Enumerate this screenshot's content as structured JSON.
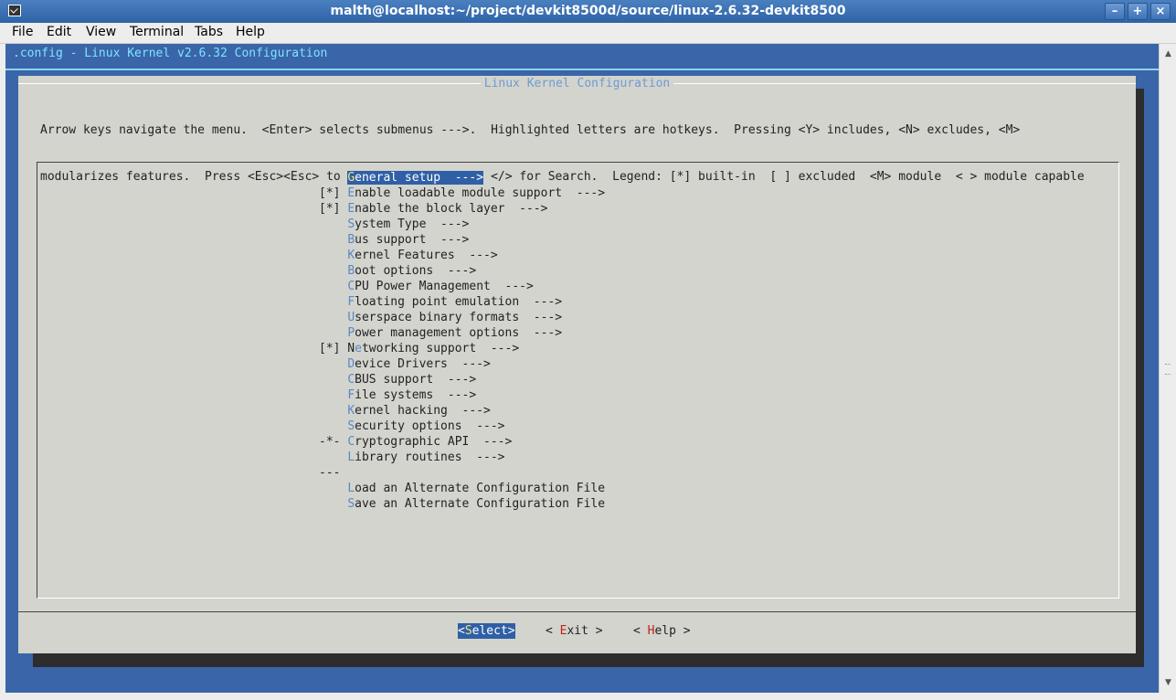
{
  "window": {
    "title": "malth@localhost:~/project/devkit8500d/source/linux-2.6.32-devkit8500",
    "controls": {
      "minimize": "–",
      "maximize": "+",
      "close": "×"
    }
  },
  "menubar": {
    "items": [
      {
        "label": "File"
      },
      {
        "label": "Edit"
      },
      {
        "label": "View"
      },
      {
        "label": "Terminal"
      },
      {
        "label": "Tabs"
      },
      {
        "label": "Help"
      }
    ]
  },
  "terminal": {
    "header": ".config - Linux Kernel v2.6.32 Configuration",
    "dialog_title": "Linux Kernel Configuration",
    "instructions": [
      "Arrow keys navigate the menu.  <Enter> selects submenus --->.  Highlighted letters are hotkeys.  Pressing <Y> includes, <N> excludes, <M>",
      "modularizes features.  Press <Esc><Esc> to exit, <?> for Help, </> for Search.  Legend: [*] built-in  [ ] excluded  <M> module  < > module capable"
    ],
    "menu": [
      {
        "prefix": "    ",
        "hk": "G",
        "rest": "eneral setup  --->",
        "selected": true
      },
      {
        "prefix": "[*] ",
        "hk": "E",
        "rest": "nable loadable module support  --->"
      },
      {
        "prefix": "[*] ",
        "hk": "E",
        "rest": "nable the block layer  --->"
      },
      {
        "prefix": "    ",
        "hk": "S",
        "rest": "ystem Type  --->"
      },
      {
        "prefix": "    ",
        "hk": "B",
        "rest": "us support  --->"
      },
      {
        "prefix": "    ",
        "hk": "K",
        "rest": "ernel Features  --->"
      },
      {
        "prefix": "    ",
        "hk": "B",
        "rest": "oot options  --->"
      },
      {
        "prefix": "    ",
        "hk": "C",
        "rest": "PU Power Management  --->"
      },
      {
        "prefix": "    ",
        "hk": "F",
        "rest": "loating point emulation  --->"
      },
      {
        "prefix": "    ",
        "hk": "U",
        "rest": "serspace binary formats  --->"
      },
      {
        "prefix": "    ",
        "hk": "P",
        "rest": "ower management options  --->"
      },
      {
        "prefix": "[*] N",
        "hk": "e",
        "rest": "tworking support  --->"
      },
      {
        "prefix": "    ",
        "hk": "D",
        "rest": "evice Drivers  --->"
      },
      {
        "prefix": "    ",
        "hk": "C",
        "rest": "BUS support  --->"
      },
      {
        "prefix": "    ",
        "hk": "F",
        "rest": "ile systems  --->"
      },
      {
        "prefix": "    ",
        "hk": "K",
        "rest": "ernel hacking  --->"
      },
      {
        "prefix": "    ",
        "hk": "S",
        "rest": "ecurity options  --->"
      },
      {
        "prefix": "-*- ",
        "hk": "C",
        "rest": "ryptographic API  --->"
      },
      {
        "prefix": "    ",
        "hk": "L",
        "rest": "ibrary routines  --->"
      },
      {
        "prefix": "---",
        "hk": "",
        "rest": ""
      },
      {
        "prefix": "    ",
        "hk": "L",
        "rest": "oad an Alternate Configuration File"
      },
      {
        "prefix": "    ",
        "hk": "S",
        "rest": "ave an Alternate Configuration File"
      }
    ],
    "buttons": [
      {
        "pre": "<",
        "hk": "S",
        "post": "elect>",
        "active": true
      },
      {
        "pre": "< ",
        "hk": "E",
        "post": "xit >",
        "active": false
      },
      {
        "pre": "< ",
        "hk": "H",
        "post": "elp >",
        "active": false
      }
    ]
  },
  "scrollbar": {
    "up": "▲",
    "down": "▼"
  }
}
